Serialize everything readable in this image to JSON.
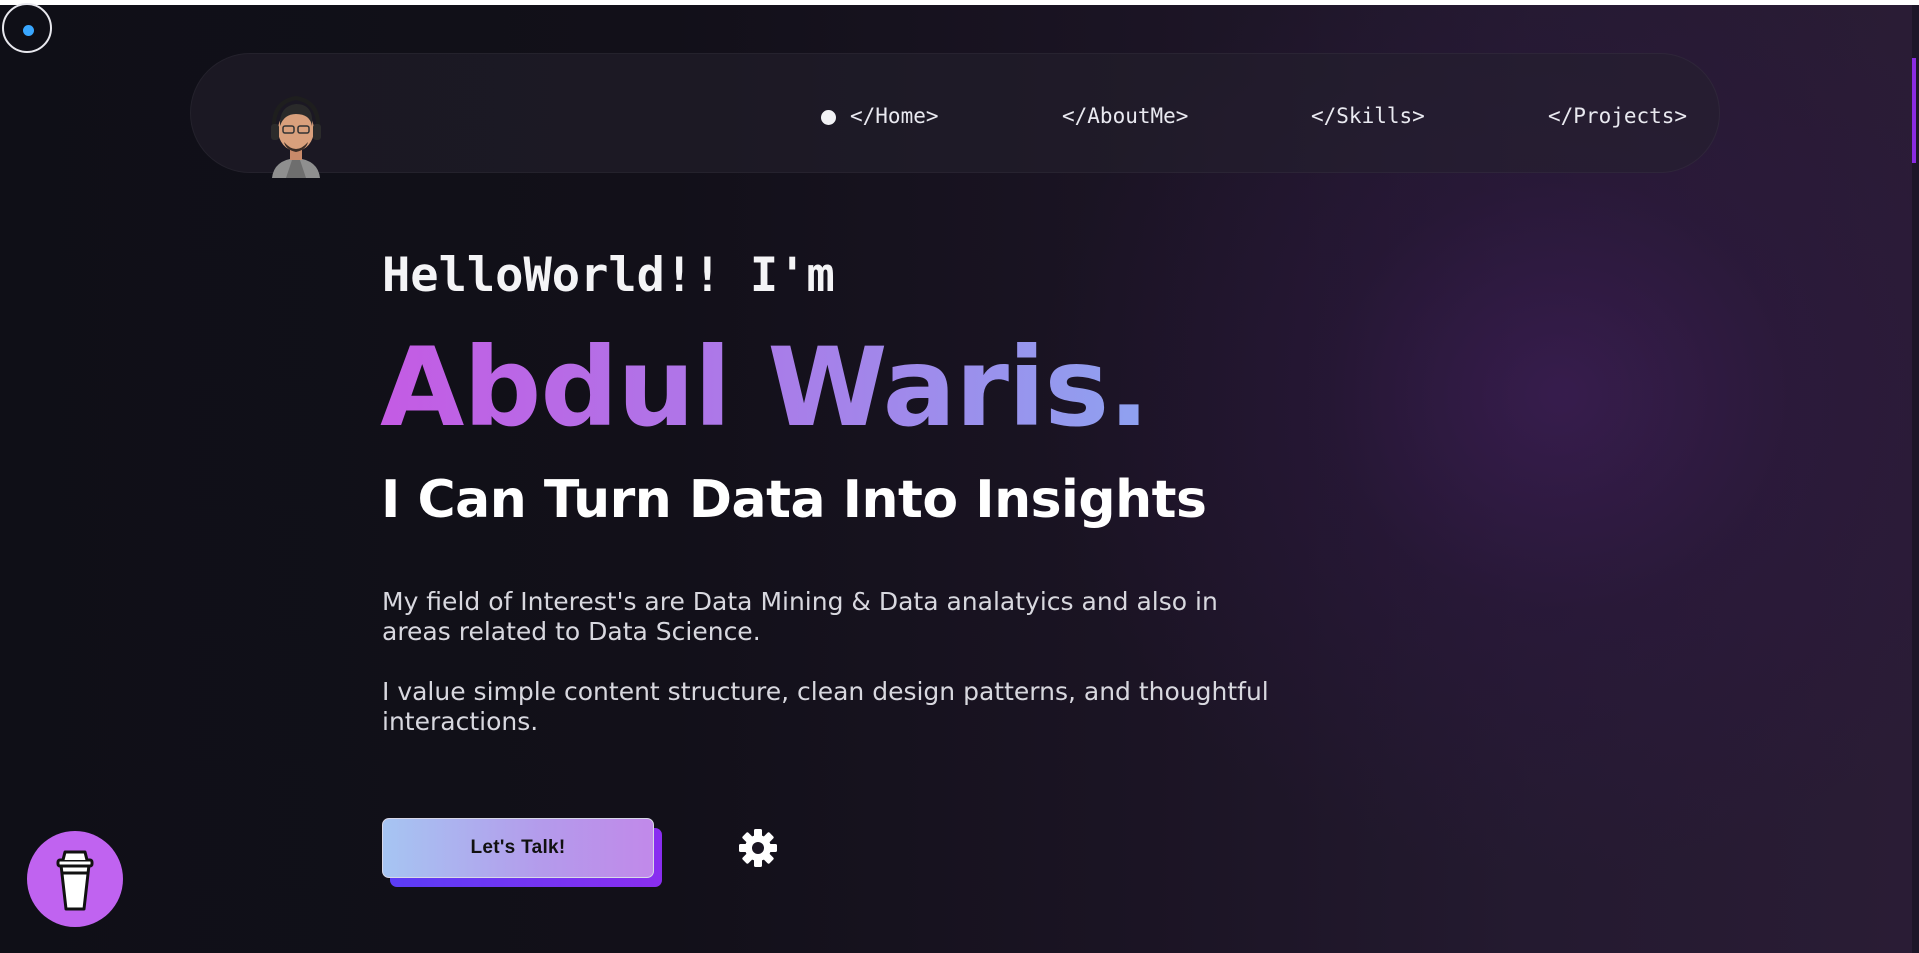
{
  "nav": {
    "items": [
      {
        "label": "</Home>",
        "active": true
      },
      {
        "label": "</AboutMe>"
      },
      {
        "label": "</Skills>"
      },
      {
        "label": "</Projects>"
      }
    ]
  },
  "hero": {
    "greeting": "HelloWorld!!  I'm",
    "name": "Abdul Waris.",
    "tagline": "I Can Turn Data Into Insights",
    "paragraph1": "My field of Interest's are Data Mining & Data analatyics and also in areas related to Data Science.",
    "paragraph2": "I value simple content structure, clean design patterns, and thoughtful interactions.",
    "cta_label": "Let's Talk!"
  },
  "icons": {
    "cursor": "cursor-ring-icon",
    "settings": "gear-icon",
    "coffee": "coffee-cup-icon",
    "avatar": "avatar"
  },
  "colors": {
    "background": "#0f0f17",
    "accent_purple": "#8a2be2",
    "name_gradient_start": "#c45be4",
    "name_gradient_end": "#8ea2f0",
    "coffee_button": "#c063f0",
    "cursor_dot": "#39a7ff"
  }
}
